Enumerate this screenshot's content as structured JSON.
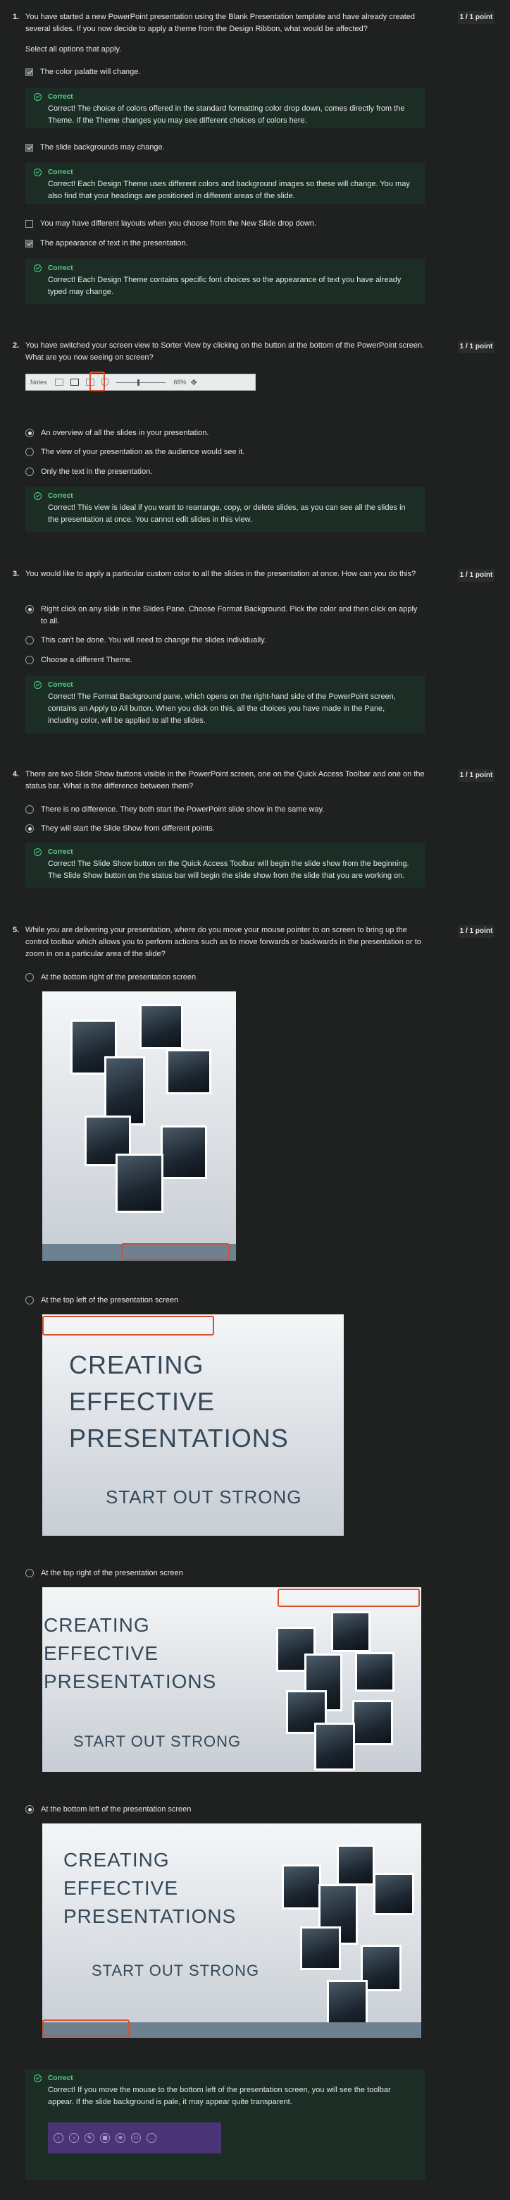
{
  "points_label": "1 / 1 point",
  "correct_label": "Correct",
  "q1": {
    "num": "1.",
    "text": "You have started a new PowerPoint presentation using the Blank Presentation template and have already created several slides. If you now decide to apply a theme from the Design Ribbon, what would be affected?",
    "instruction": "Select all options that apply.",
    "options": [
      {
        "label": "The color palatte will change.",
        "checked": true
      },
      {
        "label": "The slide backgrounds may change.",
        "checked": true
      },
      {
        "label": "You may have different layouts when you choose from the New Slide drop down.",
        "checked": false
      },
      {
        "label": "The appearance of text in the presentation.",
        "checked": true
      }
    ],
    "feedback": [
      "Correct! The choice of colors offered in the standard formatting color drop down, comes directly from the Theme. If the Theme changes you may see different choices of colors here.",
      "Correct! Each Design Theme uses different colors and background images so these will change. You may also find that your headings are positioned in different areas of the slide.",
      "Correct! Each Design Theme contains specific font choices so the appearance of text you have already typed may change."
    ]
  },
  "q2": {
    "num": "2.",
    "text": "You have switched your screen view to Sorter View by clicking on the button at the bottom of the PowerPoint screen. What are you now seeing on screen?",
    "toolbar": {
      "notes": "Notes",
      "zoom": "68%"
    },
    "options": [
      {
        "label": "An overview of all the slides in your presentation.",
        "checked": true
      },
      {
        "label": "The view of your presentation as the audience would see it.",
        "checked": false
      },
      {
        "label": "Only the text in the presentation.",
        "checked": false
      }
    ],
    "feedback": "Correct! This view is ideal if you want to rearrange, copy, or delete slides, as you can see all the slides in the presentation at once. You cannot edit slides in this view."
  },
  "q3": {
    "num": "3.",
    "text": "You would like to apply a particular custom color to all the slides in the presentation at once. How can you do this?",
    "options": [
      {
        "label": "Right click on any slide in the Slides Pane. Choose Format Background. Pick the color and then click on apply to all.",
        "checked": true
      },
      {
        "label": "This can't be done. You will need to change the slides individually.",
        "checked": false
      },
      {
        "label": "Choose a different Theme.",
        "checked": false
      }
    ],
    "feedback": "Correct! The Format Background pane, which opens on the right-hand side of the PowerPoint screen, contains an Apply to All button. When you click on this, all the choices you have made in the Pane, including color, will be applied to all the slides."
  },
  "q4": {
    "num": "4.",
    "text": "There are two Slide Show buttons visible in the PowerPoint screen, one on the Quick Access Toolbar and one on the status bar. What is the difference between them?",
    "options": [
      {
        "label": "There is no difference. They both start the PowerPoint slide show in the same way.",
        "checked": false
      },
      {
        "label": "They will start the Slide Show from different points.",
        "checked": true
      }
    ],
    "feedback": "Correct! The Slide Show button on the Quick Access Toolbar will begin the slide show from the beginning. The Slide Show button on the status bar will begin the slide show from the slide that you are working on."
  },
  "q5": {
    "num": "5.",
    "text": "While you are delivering your presentation, where do you move your mouse pointer to on screen to bring up the control toolbar which allows you to perform actions such as to move forwards or backwards in the presentation or to zoom in on a particular area of the slide?",
    "options": [
      {
        "label": "At the bottom right of the presentation screen",
        "checked": false
      },
      {
        "label": "At the top left of the presentation screen",
        "checked": false
      },
      {
        "label": "At the top right of the presentation screen",
        "checked": false
      },
      {
        "label": "At the bottom left of the presentation screen",
        "checked": true
      }
    ],
    "slide_title_lines": [
      "CREATING",
      "EFFECTIVE",
      "PRESENTATIONS"
    ],
    "slide_subtitle": "START OUT STRONG",
    "feedback": "Correct! If you move the mouse to the bottom left of the presentation screen, you will see the toolbar appear. If the slide background is pale, it may appear quite transparent."
  }
}
